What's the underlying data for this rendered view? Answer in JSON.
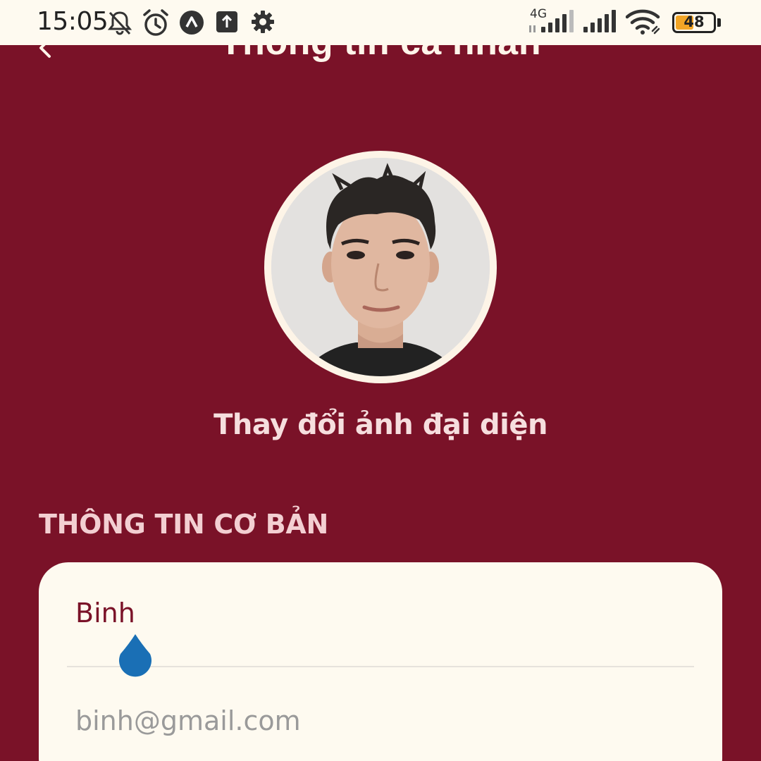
{
  "status_bar": {
    "time": "15:05",
    "network_label": "4G",
    "battery_level": "48",
    "battery_fraction": 0.48,
    "icons": [
      "bell-off-icon",
      "alarm-icon",
      "app-a-icon",
      "upload-icon",
      "settings-icon",
      "signal-4g-icon",
      "signal-icon",
      "wifi-icon",
      "battery-icon"
    ]
  },
  "header": {
    "title": "Thông tin cá nhân",
    "back_icon": "chevron-left-icon"
  },
  "profile": {
    "change_avatar_label": "Thay đổi ảnh đại diện"
  },
  "basic_info": {
    "section_title": "THÔNG TIN CƠ BẢN",
    "name_value": "Binh",
    "email_placeholder": "binh@gmail.com"
  },
  "colors": {
    "background": "#7a1228",
    "card": "#fefaf0",
    "accent_handle": "#1a6fb5",
    "battery": "#f2a526"
  }
}
